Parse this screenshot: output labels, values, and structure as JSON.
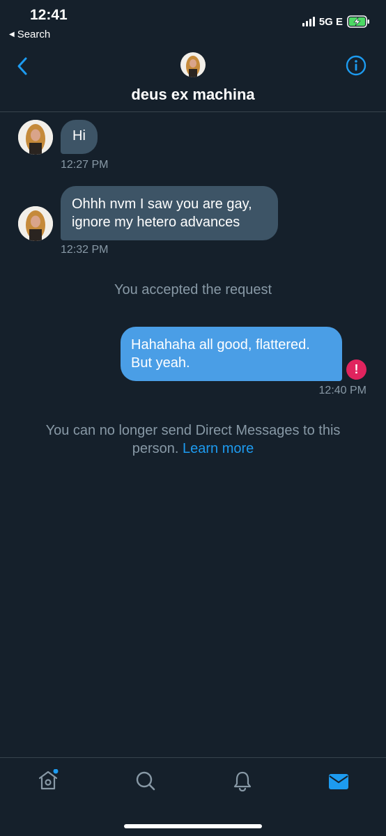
{
  "status_bar": {
    "time": "12:41",
    "back_label": "Search",
    "network": "5G E"
  },
  "header": {
    "contact_name": "deus ex machina",
    "back_icon": "chevron-left-icon",
    "info_icon": "info-icon"
  },
  "messages": [
    {
      "direction": "incoming",
      "text": "Hi",
      "time": "12:27 PM"
    },
    {
      "direction": "incoming",
      "text_line1": "Ohhh nvm I saw you are gay,",
      "text_line2": "ignore my hetero advances",
      "time": "12:32 PM"
    }
  ],
  "system": {
    "accepted": "You accepted the request",
    "no_longer_line1": "You can no longer send Direct Messages to this",
    "no_longer_line2": "person.",
    "learn_more": "Learn more"
  },
  "outgoing": {
    "text_line1": "Hahahaha all good, flattered.",
    "text_line2": "But yeah.",
    "time": "12:40 PM",
    "error_glyph": "!"
  },
  "bottom_nav": {
    "items": [
      "home-icon",
      "search-icon",
      "bell-icon",
      "mail-icon"
    ],
    "active": "mail-icon"
  },
  "colors": {
    "background": "#15202b",
    "accent": "#1d9bf0",
    "incoming_bubble": "#3d5466",
    "outgoing_bubble": "#4a9ee6",
    "muted_text": "#8899a6",
    "error": "#e0245e",
    "battery_charging": "#4cd964"
  }
}
